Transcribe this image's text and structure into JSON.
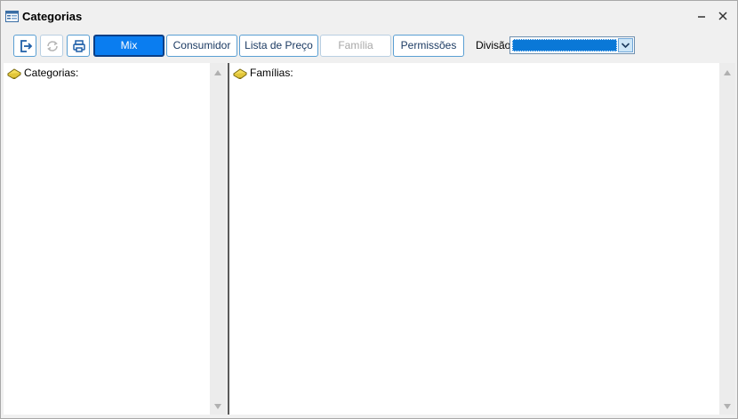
{
  "window": {
    "title": "Categorias"
  },
  "toolbar": {
    "exit_icon": "exit-icon",
    "refresh_icon": "refresh-icon",
    "print_icon": "print-icon",
    "buttons": [
      {
        "label": "Mix",
        "state": "active"
      },
      {
        "label": "Consumidor",
        "state": "normal"
      },
      {
        "label": "Lista de Preço",
        "state": "normal"
      },
      {
        "label": "Família",
        "state": "disabled"
      },
      {
        "label": "Permissões",
        "state": "normal"
      }
    ],
    "divisao_label": "Divisão",
    "divisao_value": ""
  },
  "left_tree": {
    "root_label": "Categorias:",
    "icon": "book-icon"
  },
  "right_tree": {
    "root_label": "Famílias:",
    "icon": "book-icon"
  },
  "colors": {
    "accent": "#0a7df0",
    "border_blue": "#5a9fd3",
    "selection": "#0a78d7"
  }
}
